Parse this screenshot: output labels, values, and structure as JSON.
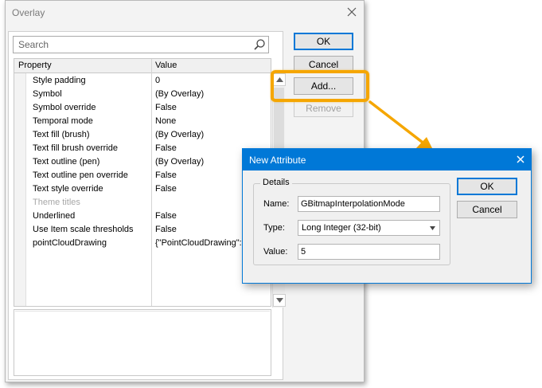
{
  "overlay_dialog": {
    "title": "Overlay",
    "search_placeholder": "Search",
    "grid": {
      "columns": [
        "Property",
        "Value"
      ],
      "rows": [
        {
          "property": "Style padding",
          "value": "0",
          "dimmed": false
        },
        {
          "property": "Symbol",
          "value": " (By Overlay)",
          "dimmed": false
        },
        {
          "property": "Symbol override",
          "value": "False",
          "dimmed": false
        },
        {
          "property": "Temporal mode",
          "value": "None",
          "dimmed": false
        },
        {
          "property": "Text fill (brush)",
          "value": " (By Overlay)",
          "dimmed": false
        },
        {
          "property": "Text fill brush override",
          "value": "False",
          "dimmed": false
        },
        {
          "property": "Text outline (pen)",
          "value": " (By Overlay)",
          "dimmed": false
        },
        {
          "property": "Text outline pen override",
          "value": "False",
          "dimmed": false
        },
        {
          "property": "Text style override",
          "value": "False",
          "dimmed": false
        },
        {
          "property": "Theme titles",
          "value": "",
          "dimmed": true
        },
        {
          "property": "Underlined",
          "value": "False",
          "dimmed": false
        },
        {
          "property": "Use Item scale thresholds",
          "value": "False",
          "dimmed": false
        },
        {
          "property": "pointCloudDrawing",
          "value": "{\"PointCloudDrawing\":{",
          "dimmed": false
        }
      ]
    },
    "buttons": {
      "ok": "OK",
      "cancel": "Cancel",
      "add": "Add...",
      "remove": "Remove"
    }
  },
  "new_attribute_dialog": {
    "title": "New Attribute",
    "group_label": "Details",
    "name_label": "Name:",
    "name_value": "GBitmapInterpolationMode",
    "type_label": "Type:",
    "type_value": "Long Integer (32-bit)",
    "value_label": "Value:",
    "value_value": "5",
    "ok": "OK",
    "cancel": "Cancel"
  },
  "colors": {
    "accent": "#0078d7",
    "highlight": "#f5a600",
    "disabled_text": "#a0a0a0"
  },
  "icons": [
    "close-icon",
    "search-icon",
    "scroll-up-icon",
    "scroll-down-icon",
    "dropdown-arrow-icon"
  ]
}
